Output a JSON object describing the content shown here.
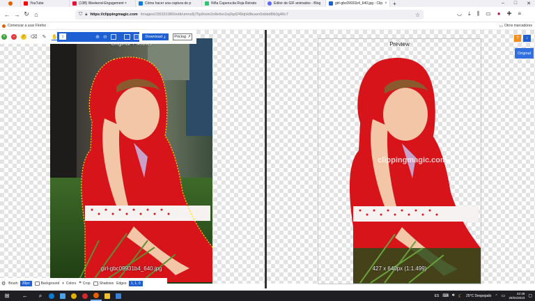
{
  "browser": {
    "tabs": [
      {
        "label": "",
        "icon": "firefox-icon",
        "color": "#e66000"
      },
      {
        "label": "YouTube",
        "icon": "youtube-icon",
        "color": "#ff0000"
      },
      {
        "label": "(13B) Weekend-Engagement ×",
        "icon": "hive-icon",
        "color": "#e31337"
      },
      {
        "label": "Cómo hacer una captura de p",
        "icon": "edge-icon",
        "color": "#0a7cd8"
      },
      {
        "label": "Niña Caperucita Roja Retrato",
        "icon": "pixabay-icon",
        "color": "#2ec66e"
      },
      {
        "label": "Editor de GIF animados - Blog",
        "icon": "star-icon",
        "color": "#5b6bff"
      },
      {
        "label": "girl-gbc09931b4_640.jpg - Clip",
        "icon": "clipping-icon",
        "color": "#1e5fd3"
      }
    ],
    "new_tab_label": "+",
    "url_host": "https://clippingmagic.com",
    "url_path": "/images/155331980/edit/umnx8j75p9/uim2o8efoo1tq0qd249qhk8buwn0obbd8ib3g46c7",
    "bookmarks": {
      "left": "Comenzar a usar Firefox",
      "right": "Otros marcadores"
    }
  },
  "editor": {
    "toolbar": {
      "size_value": "1",
      "download_label": "Download",
      "pricing_label": "Pricing"
    },
    "original_label": "Original + Marks",
    "original_filename": "girl-gbc09931b4_640.jpg",
    "preview_label": "Preview",
    "preview_dims": "427 x 640px (1:1.499)",
    "watermark": "clippingmagic.com",
    "original_button": "Original",
    "orange_button": "?",
    "blue_button": "↓",
    "bottom": {
      "brush_label": "Brush:",
      "brush_value": "20px",
      "background_label": "Background",
      "colors_label": "Colors",
      "crop_label": "Crop",
      "shadows_label": "Shadows",
      "edges_label": "Edges:",
      "edges_value": "1, 1, 0"
    }
  },
  "taskbar": {
    "weather": "25°C  Despejado",
    "lang": "ES",
    "time": "22:49",
    "date": "29/04/2023"
  },
  "colors": {
    "accent": "#1e5fd3",
    "orange": "#f28c1a",
    "red_dress": "#d8141b"
  }
}
